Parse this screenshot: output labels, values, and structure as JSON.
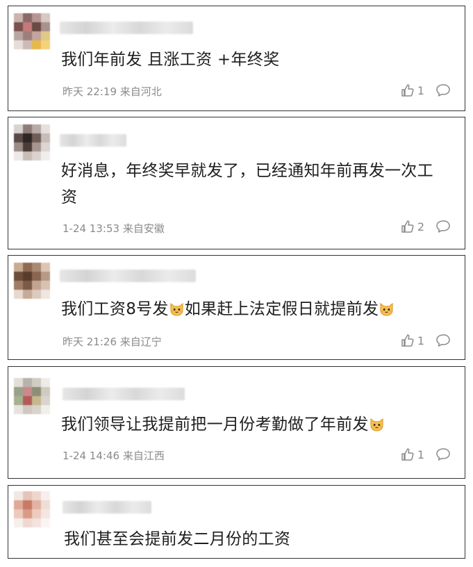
{
  "comments": [
    {
      "text": "我们年前发 且涨工资 +年终奖",
      "time": "昨天 22:19",
      "location": "来自河北",
      "likes": "1"
    },
    {
      "text": "好消息，年终奖早就发了，已经通知年前再发一次工资",
      "time": "1-24 13:53",
      "location": "来自安徽",
      "likes": "2"
    },
    {
      "text_a": "我们工资8号发",
      "text_b": "如果赶上法定假日就提前发",
      "emoji": "cat-face-emoji",
      "time": "昨天 21:26",
      "location": "来自辽宁",
      "likes": "1"
    },
    {
      "text": "我们领导让我提前把一月份考勤做了年前发",
      "emoji": "cat-face-emoji",
      "time": "1-24 14:46",
      "location": "来自江西",
      "likes": "1"
    },
    {
      "text": "我们甚至会提前发二月份的工资"
    }
  ],
  "icons": {
    "like": "thumbs-up-icon",
    "comment": "comment-bubble-icon"
  },
  "colors": {
    "text": "#1e1e1e",
    "meta": "#8a8a8a",
    "border": "#333333"
  }
}
